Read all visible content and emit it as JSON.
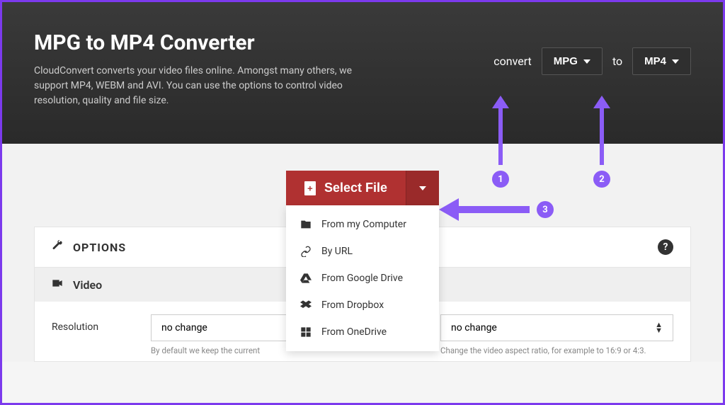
{
  "header": {
    "title": "MPG to MP4 Converter",
    "description": "CloudConvert converts your video files online. Amongst many others, we support MP4, WEBM and AVI. You can use the options to control video resolution, quality and file size."
  },
  "convert": {
    "label_convert": "convert",
    "from_format": "MPG",
    "label_to": "to",
    "to_format": "MP4"
  },
  "select_file": {
    "button_label": "Select File",
    "menu": [
      {
        "icon": "folder-icon",
        "label": "From my Computer"
      },
      {
        "icon": "link-icon",
        "label": "By URL"
      },
      {
        "icon": "gdrive-icon",
        "label": "From Google Drive"
      },
      {
        "icon": "dropbox-icon",
        "label": "From Dropbox"
      },
      {
        "icon": "onedrive-icon",
        "label": "From OneDrive"
      }
    ]
  },
  "options": {
    "heading": "OPTIONS",
    "section_video": "Video",
    "resolution_label": "Resolution",
    "resolution_value": "no change",
    "resolution_help": "By default we keep the current",
    "aspect_value": "no change",
    "aspect_help": "Change the video aspect ratio, for example to 16:9 or 4:3."
  },
  "annotations": {
    "badge1": "1",
    "badge2": "2",
    "badge3": "3"
  }
}
